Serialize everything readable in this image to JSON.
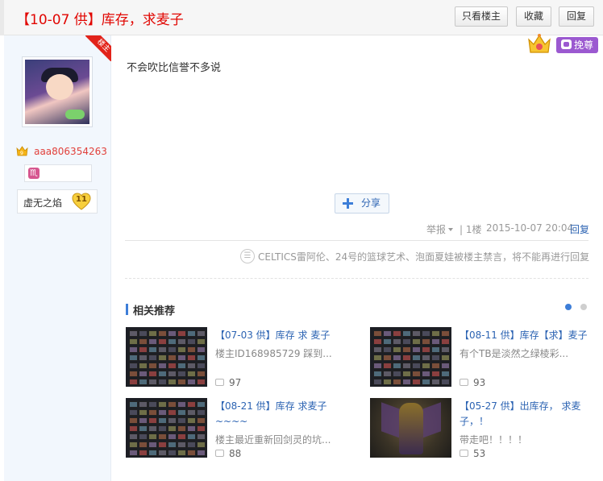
{
  "post": {
    "title": "【10-07 供】库存，求麦子",
    "content": "不会吹比信誉不多说"
  },
  "toolbar": {
    "only_author": "只看楼主",
    "favorite": "收藏",
    "reply": "回复"
  },
  "author": {
    "ribbon": "楼主",
    "username": "aaa806354263",
    "badge_sign": "♏",
    "level_name": "虚无之焰",
    "level": "11"
  },
  "wanzun": {
    "label": "挽尊"
  },
  "share": {
    "label": "分享"
  },
  "meta": {
    "report": "举报",
    "floor": "| 1楼",
    "time": "2015-10-07 20:04",
    "reply": "回复"
  },
  "ban_notice": "CELTICS雷阿伦、24号的篮球艺术、泡面夏娃被楼主禁言，将不能再进行回复",
  "related": {
    "heading": "相关推荐",
    "items": [
      {
        "title": "【07-03 供】库存 求 麦子",
        "desc": "楼主ID168985729 踩到...",
        "count": "97"
      },
      {
        "title": "【08-11 供】库存【求】麦子",
        "desc": "有个TB是淡然之绿棱彩...",
        "count": "93"
      },
      {
        "title": "【08-21 供】库存 求麦子 ~~~~",
        "desc": "楼主最近重新回剑灵的坑...",
        "count": "88"
      },
      {
        "title": "【05-27 供】出库存， 求麦子，！",
        "desc": "带走吧！！！！",
        "count": "53"
      }
    ]
  },
  "colors": {
    "title_red": "#e10602",
    "link_blue": "#2d64b3",
    "wanzun_purple": "#9b59d0",
    "sidebar_bg": "#f2f7fd"
  }
}
